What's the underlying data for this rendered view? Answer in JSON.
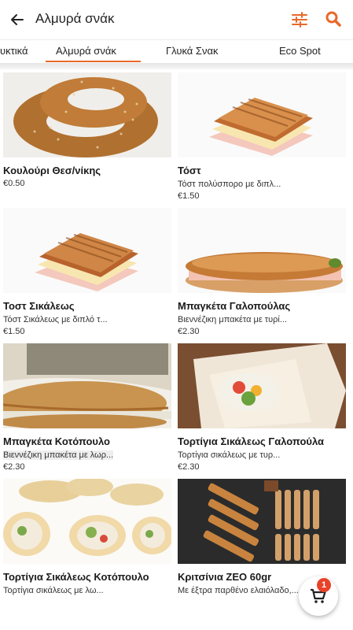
{
  "header": {
    "title": "Αλμυρά σνάκ",
    "back_icon": "arrow-left-icon",
    "filter_icon": "sliders-icon",
    "search_icon": "search-icon",
    "accent_color": "#e8692a"
  },
  "tabs": [
    {
      "label": "υκτικά"
    },
    {
      "label": "Αλμυρά σνάκ",
      "active": true
    },
    {
      "label": "Γλυκά Σνακ"
    },
    {
      "label": "Eco Spot"
    }
  ],
  "products": [
    {
      "name": "Κουλούρι Θεσ/νίκης",
      "description": "",
      "price": "€0.50",
      "image": "koulouri-image"
    },
    {
      "name": "Τόστ",
      "description": "Τόστ πολύσπορο με διπλ...",
      "price": "€1.50",
      "image": "toast-image"
    },
    {
      "name": "Τοστ Σικάλεως",
      "description": "Τόστ Σικάλεως με διπλό τ...",
      "price": "€1.50",
      "image": "rye-toast-image"
    },
    {
      "name": "Μπαγκέτα Γαλοπούλας",
      "description": "Βιεννέζικη μπακέτα με τυρί...",
      "price": "€2.30",
      "image": "turkey-baguette-image"
    },
    {
      "name": "Μπαγκέτα Κοτόπουλο",
      "description": "Βιεννέζικη μπακέτα με λωρ...",
      "price": "€2.30",
      "image": "chicken-baguette-image"
    },
    {
      "name": "Τορτίγια Σικάλεως Γαλοπούλα",
      "description": "Τορτίγια σικάλεως με τυρ...",
      "price": "€2.30",
      "image": "turkey-tortilla-image"
    },
    {
      "name": "Τορτίγια Σικάλεως Κοτόπουλο",
      "description": "Τορτίγια σικάλεως με λω...",
      "price": "",
      "image": "chicken-tortilla-image"
    },
    {
      "name": "Κριτσίνια ΖΕΟ 60gr",
      "description": "Με έξτρα παρθένο ελαιόλαδο,...",
      "price": "",
      "image": "breadsticks-image"
    }
  ],
  "cart": {
    "icon": "cart-icon",
    "count": "1"
  }
}
